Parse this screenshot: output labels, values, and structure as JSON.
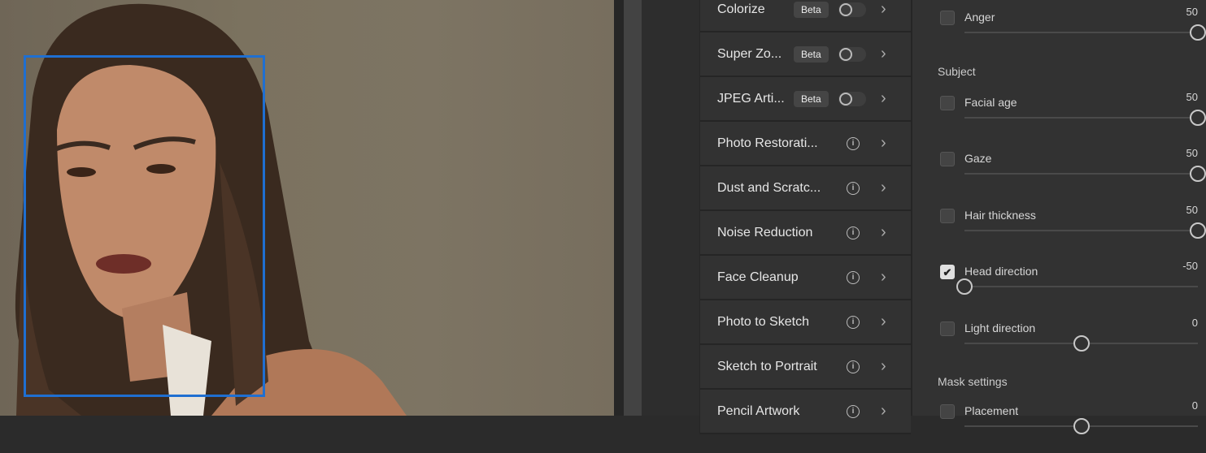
{
  "filters": [
    {
      "name": "Colorize",
      "badge": "Beta",
      "control": "toggle",
      "enabled": false
    },
    {
      "name": "Super Zo...",
      "badge": "Beta",
      "control": "toggle",
      "enabled": false
    },
    {
      "name": "JPEG Arti...",
      "badge": "Beta",
      "control": "toggle",
      "enabled": false
    },
    {
      "name": "Photo Restorati...",
      "control": "info"
    },
    {
      "name": "Dust and Scratc...",
      "control": "info"
    },
    {
      "name": "Noise Reduction",
      "control": "info"
    },
    {
      "name": "Face Cleanup",
      "control": "info"
    },
    {
      "name": "Photo to Sketch",
      "control": "info"
    },
    {
      "name": "Sketch to Portrait",
      "control": "info"
    },
    {
      "name": "Pencil Artwork",
      "control": "info"
    }
  ],
  "settings": {
    "slider_range": [
      -50,
      50
    ],
    "rows": [
      {
        "label": "Anger",
        "value": "50",
        "checked": false
      },
      {
        "section": "Subject"
      },
      {
        "label": "Facial age",
        "value": "50",
        "checked": false
      },
      {
        "label": "Gaze",
        "value": "50",
        "checked": false
      },
      {
        "label": "Hair thickness",
        "value": "50",
        "checked": false
      },
      {
        "label": "Head direction",
        "value": "-50",
        "checked": true
      },
      {
        "label": "Light direction",
        "value": "0",
        "checked": false
      },
      {
        "section": "Mask settings"
      },
      {
        "label": "Placement",
        "value": "0",
        "checked": false
      }
    ]
  },
  "colors": {
    "face_box": "#1f6fd1",
    "panel": "#323232"
  }
}
